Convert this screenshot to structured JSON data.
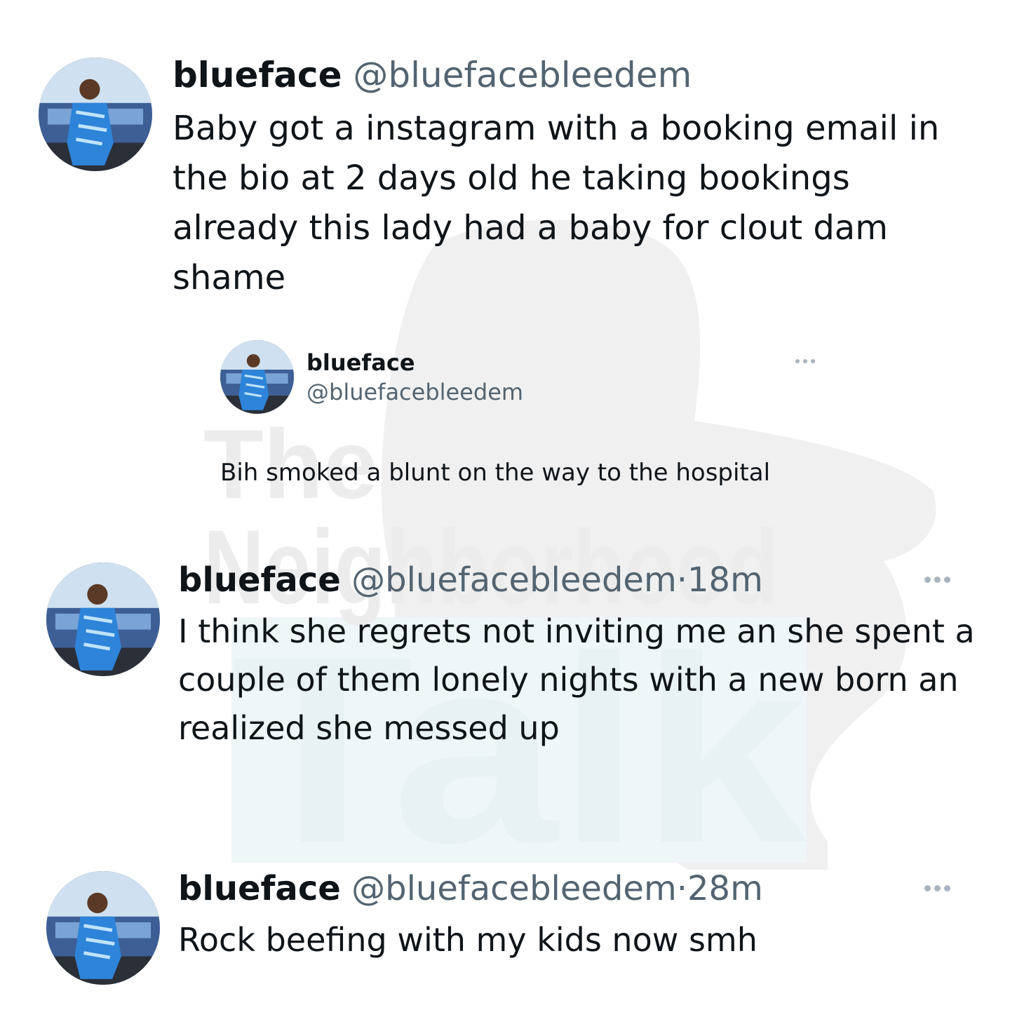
{
  "tweets": [
    {
      "name": "blueface",
      "handle": "@bluefacebleedem",
      "text": "Baby got a instagram with a booking email in the bio at 2 days old he taking bookings already this lady had a baby for clout dam shame"
    },
    {
      "name": "blueface",
      "handle": "@bluefacebleedem",
      "text": "Bih smoked a blunt on the way to the hospital"
    },
    {
      "name": "blueface",
      "handle": "@bluefacebleedem",
      "separator": "·",
      "time": "18m",
      "text": "I think she regrets not inviting me an she spent a couple of them lonely nights with a new born an realized she messed up"
    },
    {
      "name": "blueface",
      "handle": "@bluefacebleedem",
      "separator": "·",
      "time": "28m",
      "text": "Rock beefing with my kids now smh"
    }
  ],
  "watermark": {
    "line1": "The",
    "line2": "Neighborhood",
    "line3": "Talk"
  },
  "icons": {
    "avatar": "profile-photo",
    "more": "more-options-icon"
  },
  "colors": {
    "text": "#0f1419",
    "secondary": "#536471",
    "watermark_gray": "#efefef",
    "watermark_teal": "#eef6f8"
  }
}
